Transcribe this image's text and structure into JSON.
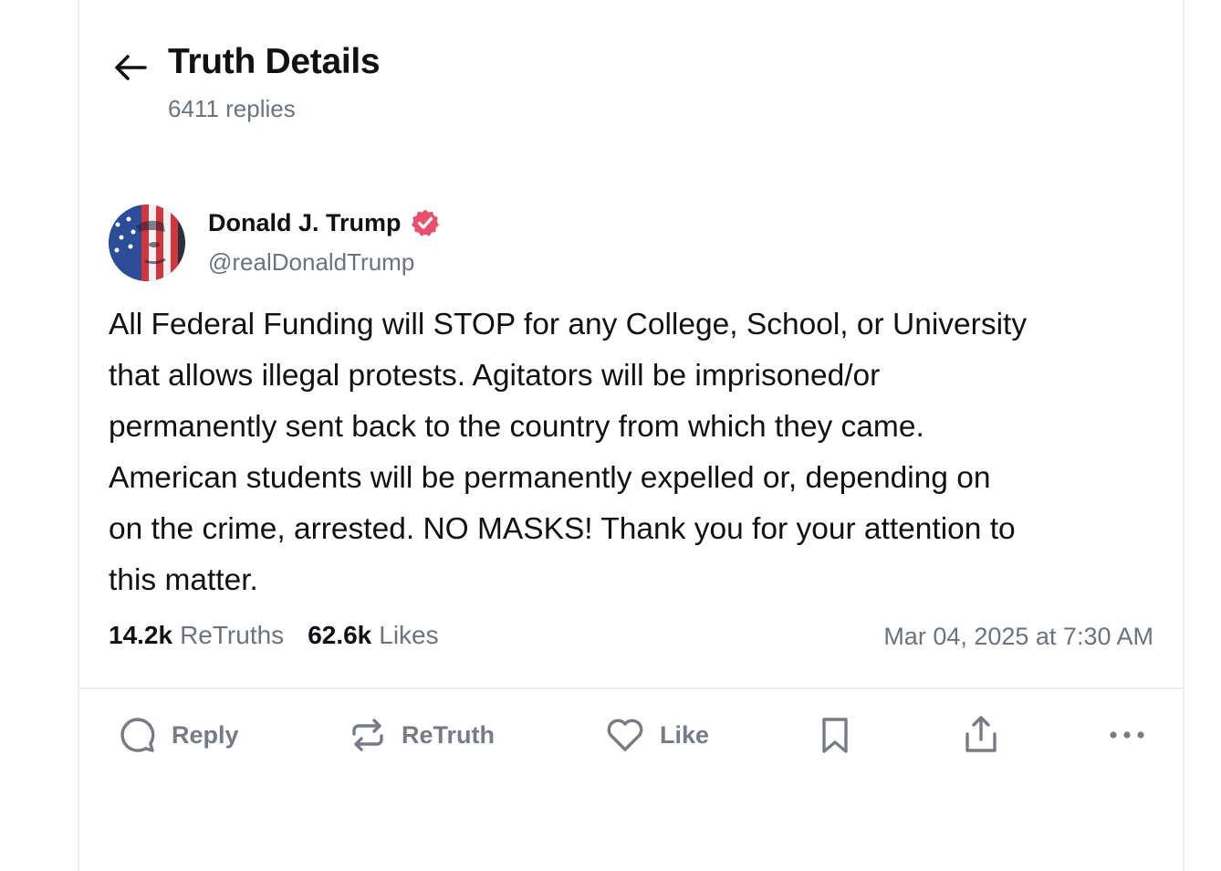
{
  "header": {
    "title": "Truth Details",
    "reply_count": "6411 replies"
  },
  "post": {
    "author_name": "Donald J. Trump",
    "author_handle": "@realDonaldTrump",
    "text": "All Federal Funding will STOP for any College, School, or University\nthat allows illegal protests. Agitators will be imprisoned/or\npermanently sent back to the country from which they came.\nAmerican students will be permanently expelled or, depending on\non the crime, arrested. NO MASKS! Thank you for your attention to\nthis matter.",
    "retruths_count": "14.2k",
    "retruths_label": "ReTruths",
    "likes_count": "62.6k",
    "likes_label": "Likes",
    "timestamp": "Mar 04, 2025 at 7:30 AM"
  },
  "actions": {
    "reply": "Reply",
    "retruth": "ReTruth",
    "like": "Like"
  },
  "icons": {
    "back": "arrow-left-icon",
    "verified": "verified-badge-icon",
    "reply": "speech-bubble-icon",
    "retruth": "repeat-icon",
    "like": "heart-icon",
    "bookmark": "bookmark-icon",
    "share": "share-icon",
    "more": "more-icon"
  },
  "colors": {
    "verified_badge": "#e8506e",
    "muted_text": "#6b7280",
    "action_gray": "#767b85"
  }
}
